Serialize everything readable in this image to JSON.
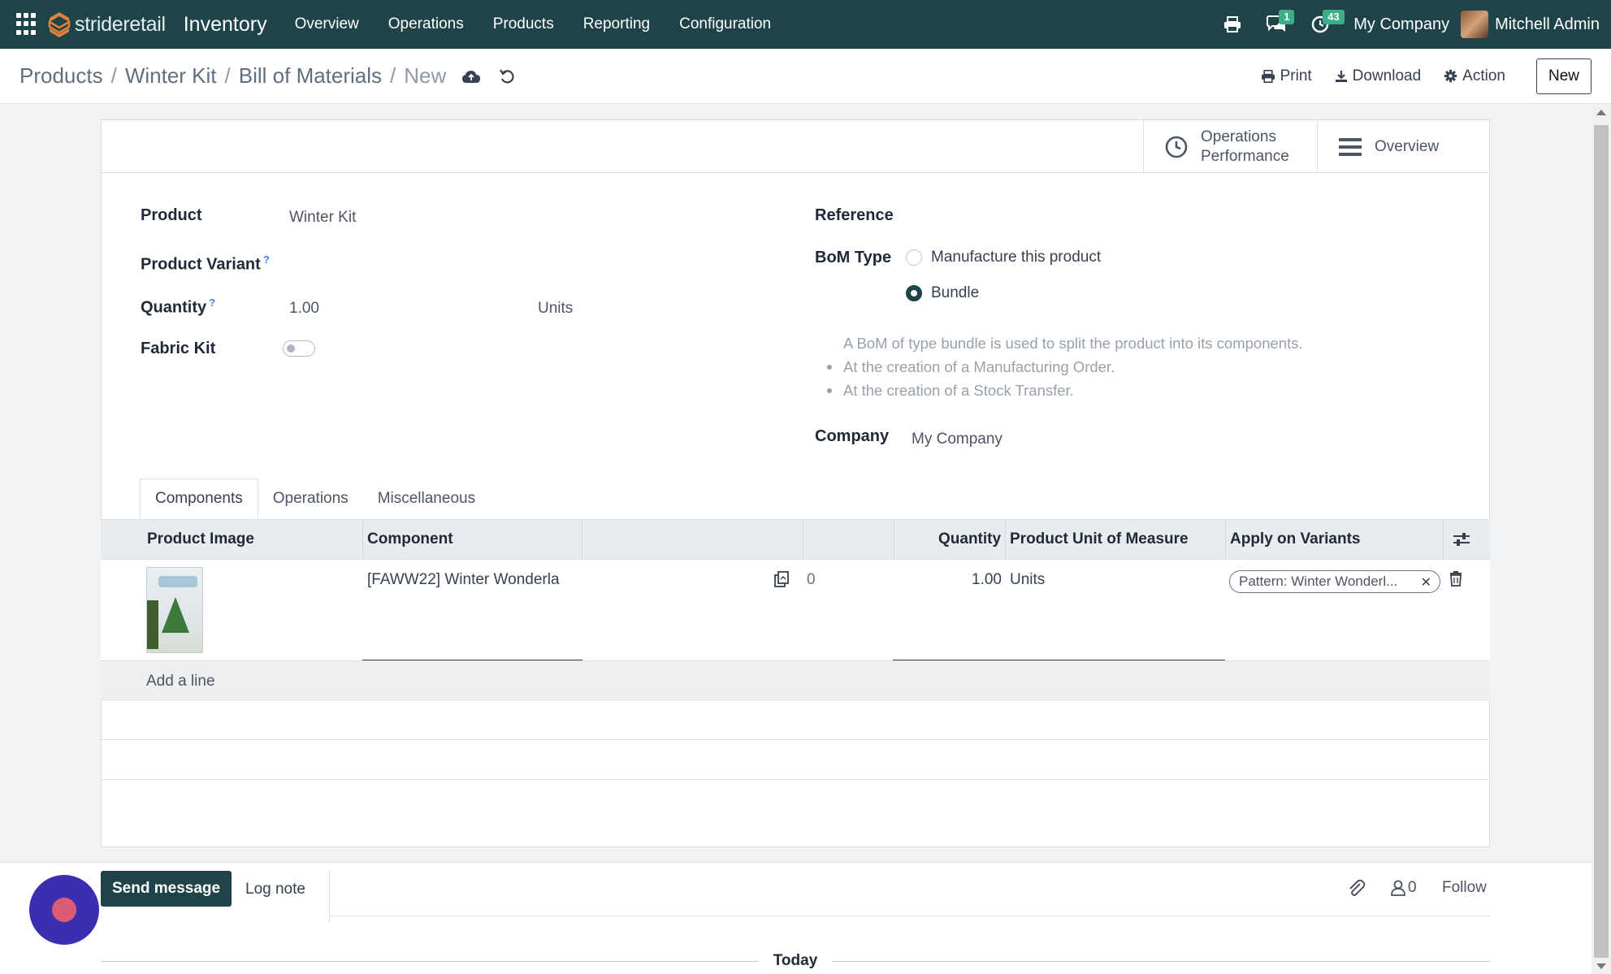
{
  "navbar": {
    "brand": "strideretail",
    "app_name": "Inventory",
    "menu": [
      "Overview",
      "Operations",
      "Products",
      "Reporting",
      "Configuration"
    ],
    "messages_badge": "1",
    "activities_badge": "43",
    "company": "My Company",
    "user": "Mitchell Admin"
  },
  "control_panel": {
    "breadcrumbs": [
      "Products",
      "Winter Kit",
      "Bill of Materials",
      "New"
    ],
    "print_label": "Print",
    "download_label": "Download",
    "action_label": "Action",
    "new_label": "New"
  },
  "smart_buttons": {
    "operations_performance": [
      "Operations",
      "Performance"
    ],
    "overview": "Overview"
  },
  "form": {
    "product_label": "Product",
    "product_value": "Winter Kit",
    "variant_label": "Product Variant",
    "quantity_label": "Quantity",
    "quantity_value": "1.00",
    "quantity_uom": "Units",
    "fabric_kit_label": "Fabric Kit",
    "fabric_kit_on": false,
    "reference_label": "Reference",
    "bom_type_label": "BoM Type",
    "bom_type_options": [
      "Manufacture this product",
      "Bundle"
    ],
    "bom_type_selected": "Bundle",
    "help_text": [
      "A BoM of type bundle is used to split the product into its components.",
      "At the creation of a Manufacturing Order.",
      "At the creation of a Stock Transfer."
    ],
    "company_label": "Company",
    "company_value": "My Company",
    "help_marker": "?"
  },
  "tabs": [
    "Components",
    "Operations",
    "Miscellaneous"
  ],
  "active_tab": "Components",
  "components_table": {
    "columns": [
      "Product Image",
      "Component",
      "",
      "",
      "Quantity",
      "Product Unit of Measure",
      "Apply on Variants"
    ],
    "rows": [
      {
        "component": "[FAWW22] Winter Wonderla",
        "forecast": "0",
        "quantity": "1.00",
        "uom": "Units",
        "variants_tag": "Pattern: Winter Wonderl..."
      }
    ],
    "add_line": "Add a line"
  },
  "chatter": {
    "send_message": "Send message",
    "log_note": "Log note",
    "followers_count": "0",
    "follow_label": "Follow",
    "today_label": "Today"
  },
  "colors": {
    "navbar": "#1e4449",
    "badge": "#3dae8a",
    "primary_button": "#1e4449"
  }
}
